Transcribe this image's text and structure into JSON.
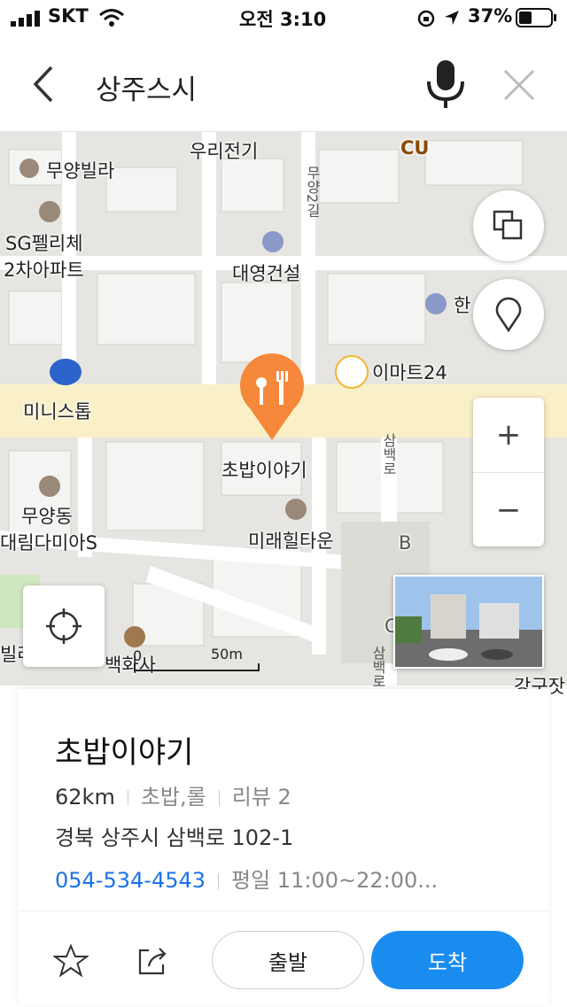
{
  "status_bar": {
    "carrier": "SKT",
    "time": "오전 3:10",
    "battery": "37%",
    "icons": [
      "signal-icon",
      "wifi-icon",
      "rotation-lock-icon",
      "location-arrow-icon",
      "battery-icon"
    ]
  },
  "search": {
    "query": "상주스시",
    "icons": [
      "back-icon",
      "microphone-icon",
      "close-icon"
    ]
  },
  "map": {
    "labels": {
      "woori": "우리전기",
      "cu": "CU",
      "muyang_villa": "무양빌라",
      "sg1": "SG펠리체",
      "sg2": "2차아파트",
      "daeyoung": "대영건설",
      "han": "한",
      "emart": "이마트24",
      "ministop": "미니스톱",
      "chobap": "초밥이야기",
      "muyang_dong": "무양동",
      "daelim": "대림다미아S",
      "mirae": "미래힐타운",
      "building_b": "B",
      "building_c": "C",
      "bill": "빌라",
      "baekhwa": "백화사",
      "gagu": "강구잣",
      "road1": "무양2길",
      "road2": "삼백로",
      "road3": "삼백로"
    },
    "scale": {
      "zero": "0",
      "distance": "50m"
    },
    "controls": [
      "layers-icon",
      "pin-icon",
      "zoom-in-icon",
      "zoom-out-icon",
      "my-location-icon"
    ],
    "zoom_in": "+",
    "zoom_out": "−",
    "accent": "#f5883a"
  },
  "place": {
    "name": "초밥이야기",
    "distance": "62km",
    "category": "초밥,롤",
    "reviews": "리뷰 2",
    "address": "경북 상주시 삼백로 102-1",
    "phone": "054-534-4543",
    "hours": "평일 11:00~22:00...",
    "depart_label": "출발",
    "arrive_label": "도착",
    "icons": [
      "star-icon",
      "share-icon"
    ],
    "colors": {
      "link": "#1b73e8",
      "primary_button": "#1a8cf0"
    }
  }
}
